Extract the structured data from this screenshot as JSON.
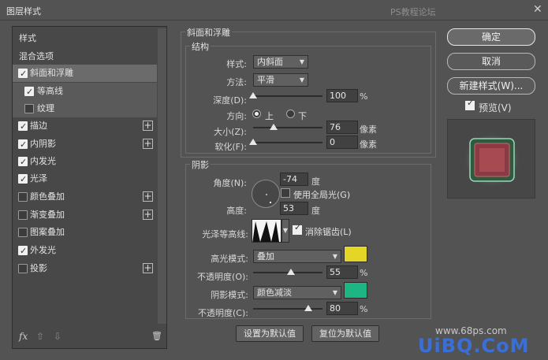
{
  "window": {
    "title": "图层样式",
    "brand": "PS教程论坛",
    "close": "✕"
  },
  "left_panel": {
    "items": [
      {
        "label": "样式",
        "checkbox": false,
        "plus": false,
        "type": "plain"
      },
      {
        "label": "混合选项",
        "checkbox": false,
        "plus": false,
        "type": "plain"
      },
      {
        "label": "斜面和浮雕",
        "checkbox": true,
        "checked": true,
        "plus": false,
        "selected": true
      },
      {
        "label": "等高线",
        "checkbox": true,
        "checked": true,
        "plus": false,
        "indent": true
      },
      {
        "label": "纹理",
        "checkbox": true,
        "checked": false,
        "plus": false,
        "indent": true
      },
      {
        "label": "描边",
        "checkbox": true,
        "checked": true,
        "plus": true
      },
      {
        "label": "内阴影",
        "checkbox": true,
        "checked": true,
        "plus": true
      },
      {
        "label": "内发光",
        "checkbox": true,
        "checked": true,
        "plus": false
      },
      {
        "label": "光泽",
        "checkbox": true,
        "checked": true,
        "plus": false
      },
      {
        "label": "颜色叠加",
        "checkbox": true,
        "checked": false,
        "plus": true
      },
      {
        "label": "渐变叠加",
        "checkbox": true,
        "checked": false,
        "plus": true
      },
      {
        "label": "图案叠加",
        "checkbox": true,
        "checked": false,
        "plus": false
      },
      {
        "label": "外发光",
        "checkbox": true,
        "checked": true,
        "plus": false
      },
      {
        "label": "投影",
        "checkbox": true,
        "checked": false,
        "plus": true
      }
    ],
    "footer": {
      "fx": "fx",
      "up": "⇧",
      "down": "⇩",
      "trash": "🗑"
    }
  },
  "bevel": {
    "title": "斜面和浮雕",
    "structure_title": "结构",
    "style_label": "样式:",
    "style_value": "内斜面",
    "technique_label": "方法:",
    "technique_value": "平滑",
    "depth_label": "深度(D):",
    "depth_value": "100",
    "depth_unit": "%",
    "depth_level": 0.0,
    "direction_label": "方向:",
    "direction_up": "上",
    "direction_down": "下",
    "size_label": "大小(Z):",
    "size_value": "76",
    "size_unit": "像素",
    "size_level": 0.3,
    "soften_label": "软化(F):",
    "soften_value": "0",
    "soften_unit": "像素",
    "soften_level": 0.0
  },
  "shading": {
    "title": "阴影",
    "angle_label": "角度(N):",
    "angle_value": "-74",
    "angle_unit": "度",
    "global_light_label": "使用全局光(G)",
    "altitude_label": "高度:",
    "altitude_value": "53",
    "altitude_unit": "度",
    "gloss_label": "光泽等高线:",
    "anti_alias_label": "消除锯齿(L)",
    "highlight_mode_label": "高光模式:",
    "highlight_mode_value": "叠加",
    "highlight_color": "#e4d626",
    "highlight_opacity_label": "不透明度(O):",
    "highlight_opacity_value": "55",
    "highlight_opacity_unit": "%",
    "highlight_opacity_level": 0.55,
    "shadow_mode_label": "阴影模式:",
    "shadow_mode_value": "颜色减淡",
    "shadow_color": "#1db584",
    "shadow_opacity_label": "不透明度(C):",
    "shadow_opacity_value": "80",
    "shadow_opacity_unit": "%",
    "shadow_opacity_level": 0.8
  },
  "bottom_buttons": {
    "set_default": "设置为默认值",
    "reset_default": "复位为默认值"
  },
  "right_panel": {
    "ok": "确定",
    "cancel": "取消",
    "new_style": "新建样式(W)...",
    "preview_label": "预览(V)"
  },
  "watermark": {
    "line1": "www.68ps.com",
    "line2": "UiBQ.CoM"
  }
}
